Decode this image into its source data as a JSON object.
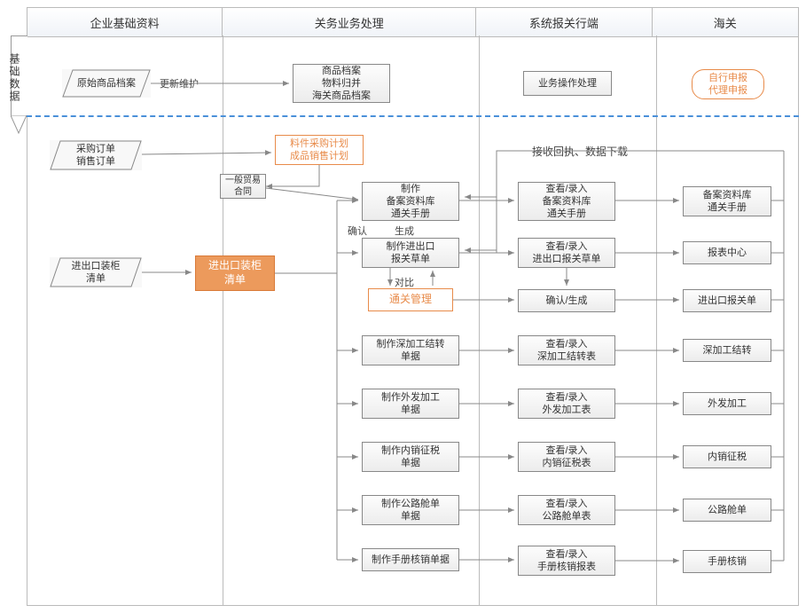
{
  "headers": {
    "c1": "企业基础资料",
    "c2": "关务业务处理",
    "c3": "系统报关行端",
    "c4": "海关"
  },
  "vlabel": "基础数据",
  "top": {
    "raw": "原始商品档案",
    "update": "更新维护",
    "archive": {
      "l1": "商品档案",
      "l2": "物料归并",
      "l3": "海关商品档案"
    },
    "op": "业务操作处理",
    "decl": {
      "l1": "自行申报",
      "l2": "代理申报"
    }
  },
  "left": {
    "po": {
      "l1": "采购订单",
      "l2": "销售订单"
    },
    "pack": {
      "l1": "进出口装柜",
      "l2": "清单"
    }
  },
  "mid": {
    "plan": {
      "l1": "料件采购计划",
      "l2": "成品销售计划"
    },
    "trade": {
      "l1": "一般贸易",
      "l2": "合同"
    },
    "packlist": {
      "l1": "进出口装柜",
      "l2": "清单"
    },
    "confirm": "确认",
    "gen": "生成",
    "compare": "对比",
    "clearance": "通关管理",
    "m1": {
      "l1": "制作",
      "l2": "备案资料库",
      "l3": "通关手册"
    },
    "m2": {
      "l1": "制作进出口",
      "l2": "报关草单"
    },
    "m4": {
      "l1": "制作深加工结转",
      "l2": "单据"
    },
    "m5": {
      "l1": "制作外发加工",
      "l2": "单据"
    },
    "m6": {
      "l1": "制作内销征税",
      "l2": "单据"
    },
    "m7": {
      "l1": "制作公路舱单",
      "l2": "单据"
    },
    "m8": "制作手册核销单据"
  },
  "sys": {
    "recv": "接收回执、数据下载",
    "s1": {
      "l1": "查看/录入",
      "l2": "备案资料库",
      "l3": "通关手册"
    },
    "s2": {
      "l1": "查看/录入",
      "l2": "进出口报关草单"
    },
    "s3": "确认/生成",
    "s4": {
      "l1": "查看/录入",
      "l2": "深加工结转表"
    },
    "s5": {
      "l1": "查看/录入",
      "l2": "外发加工表"
    },
    "s6": {
      "l1": "查看/录入",
      "l2": "内销征税表"
    },
    "s7": {
      "l1": "查看/录入",
      "l2": "公路舱单表"
    },
    "s8": {
      "l1": "查看/录入",
      "l2": "手册核销报表"
    }
  },
  "cus": {
    "c1": {
      "l1": "备案资料库",
      "l2": "通关手册"
    },
    "c2": "报表中心",
    "c3": "进出口报关单",
    "c4": "深加工结转",
    "c5": "外发加工",
    "c6": "内销征税",
    "c7": "公路舱单",
    "c8": "手册核销"
  }
}
